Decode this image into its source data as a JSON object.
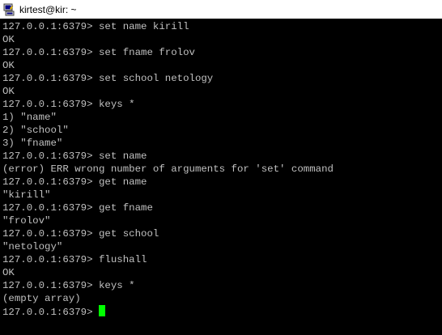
{
  "window": {
    "title": "kirtest@kir: ~",
    "icon": "putty-terminal-icon"
  },
  "terminal": {
    "lines": [
      "127.0.0.1:6379> set name kirill",
      "OK",
      "127.0.0.1:6379> set fname frolov",
      "OK",
      "127.0.0.1:6379> set school netology",
      "OK",
      "127.0.0.1:6379> keys *",
      "1) \"name\"",
      "2) \"school\"",
      "3) \"fname\"",
      "127.0.0.1:6379> set name",
      "(error) ERR wrong number of arguments for 'set' command",
      "127.0.0.1:6379> get name",
      "\"kirill\"",
      "127.0.0.1:6379> get fname",
      "\"frolov\"",
      "127.0.0.1:6379> get school",
      "\"netology\"",
      "127.0.0.1:6379> flushall",
      "OK",
      "127.0.0.1:6379> keys *",
      "(empty array)"
    ],
    "prompt": "127.0.0.1:6379> ",
    "colors": {
      "background": "#000000",
      "text": "#c0c0c0",
      "cursor": "#00ff00"
    }
  }
}
